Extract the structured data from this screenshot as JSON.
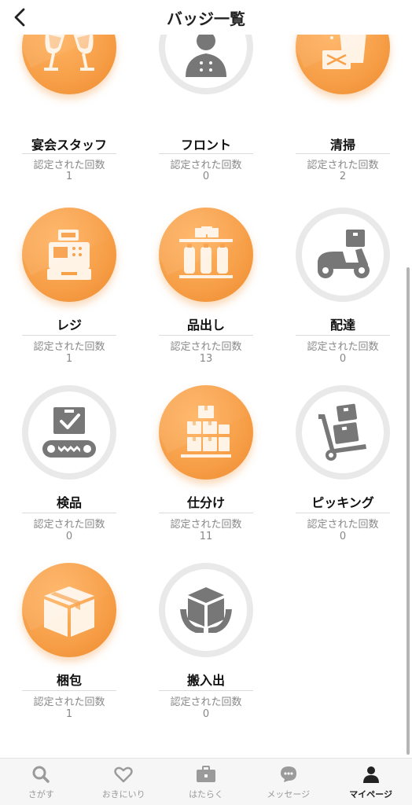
{
  "header": {
    "title": "バッジ一覧"
  },
  "badges": [
    {
      "name": "宴会スタッフ",
      "label": "認定された回数",
      "count": "1",
      "icon": "toast-glasses-icon"
    },
    {
      "name": "フロント",
      "label": "認定された回数",
      "count": "0",
      "icon": "bellhop-icon"
    },
    {
      "name": "清掃",
      "label": "認定された回数",
      "count": "2",
      "icon": "cleaning-bucket-icon"
    },
    {
      "name": "レジ",
      "label": "認定された回数",
      "count": "1",
      "icon": "cash-register-icon"
    },
    {
      "name": "品出し",
      "label": "認定された回数",
      "count": "13",
      "icon": "stock-shelf-icon"
    },
    {
      "name": "配達",
      "label": "認定された回数",
      "count": "0",
      "icon": "delivery-scooter-icon"
    },
    {
      "name": "検品",
      "label": "認定された回数",
      "count": "0",
      "icon": "inspection-conveyor-icon"
    },
    {
      "name": "仕分け",
      "label": "認定された回数",
      "count": "11",
      "icon": "sorting-boxes-icon"
    },
    {
      "name": "ピッキング",
      "label": "認定された回数",
      "count": "0",
      "icon": "hand-truck-icon"
    },
    {
      "name": "梱包",
      "label": "認定された回数",
      "count": "1",
      "icon": "package-box-icon"
    },
    {
      "name": "搬入出",
      "label": "認定された回数",
      "count": "0",
      "icon": "carry-box-icon"
    }
  ],
  "nav": [
    {
      "label": "さがす",
      "icon": "search-icon"
    },
    {
      "label": "おきにいり",
      "icon": "heart-icon"
    },
    {
      "label": "はたらく",
      "icon": "briefcase-icon"
    },
    {
      "label": "メッセージ",
      "icon": "chat-bubble-icon"
    },
    {
      "label": "マイページ",
      "icon": "user-icon"
    }
  ],
  "colors": {
    "badge_orange": "#f7a04a",
    "locked_ring": "#e9e9e9",
    "icon_gray": "#777777"
  }
}
